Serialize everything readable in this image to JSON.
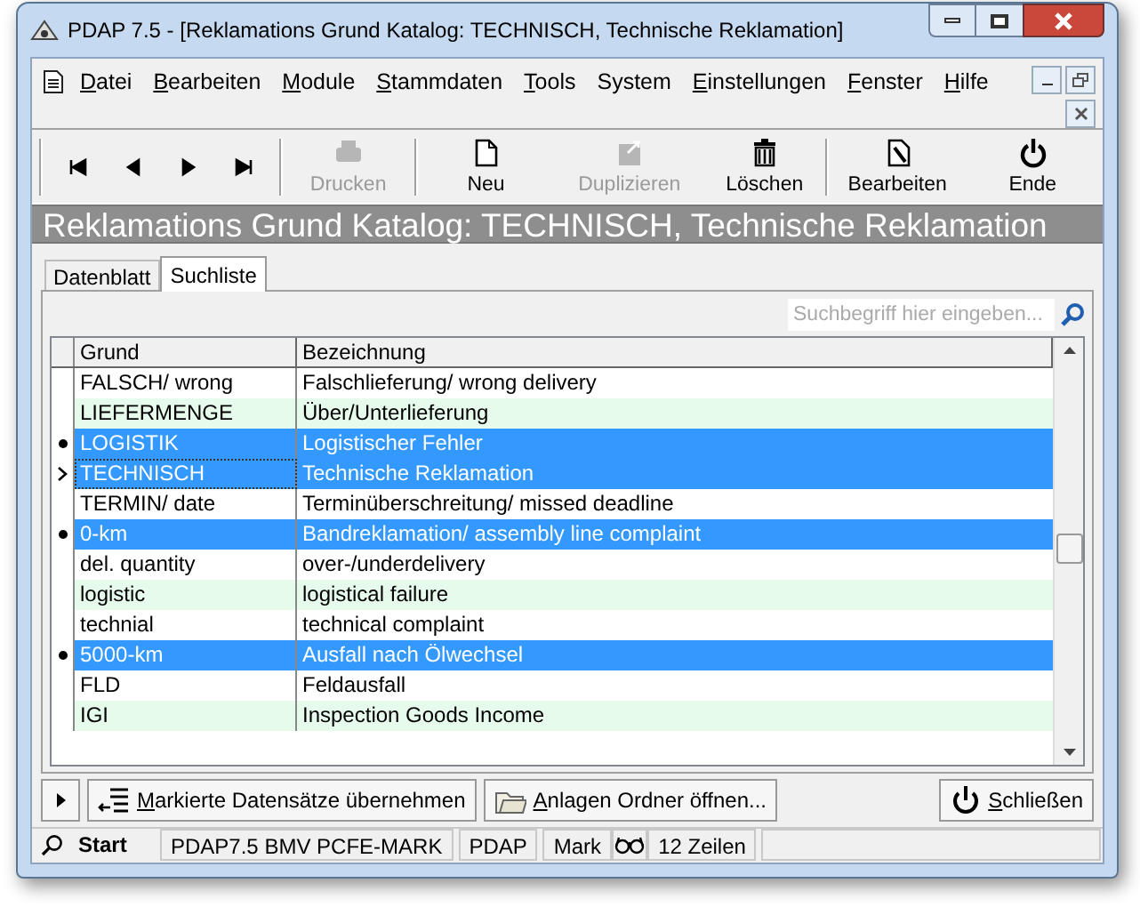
{
  "window": {
    "title": "PDAP 7.5 - [Reklamations Grund Katalog:  TECHNISCH, Technische Reklamation]"
  },
  "menu": [
    {
      "label": "Datei",
      "underlined": true
    },
    {
      "label": "Bearbeiten",
      "underlined": true
    },
    {
      "label": "Module",
      "underlined": true
    },
    {
      "label": "Stammdaten",
      "underlined": true
    },
    {
      "label": "Tools",
      "underlined": true
    },
    {
      "label": "System",
      "underlined": false
    },
    {
      "label": "Einstellungen",
      "underlined": true
    },
    {
      "label": "Fenster",
      "underlined": true
    },
    {
      "label": "Hilfe",
      "underlined": true
    }
  ],
  "toolbar": [
    {
      "kind": "nav"
    },
    {
      "kind": "print",
      "label": "Drucken",
      "disabled": true
    },
    {
      "kind": "new",
      "label": "Neu",
      "disabled": false
    },
    {
      "kind": "duplicate",
      "label": "Duplizieren",
      "disabled": true
    },
    {
      "kind": "delete",
      "label": "Löschen",
      "disabled": false
    },
    {
      "kind": "edit",
      "label": "Bearbeiten",
      "disabled": false
    },
    {
      "kind": "exit",
      "label": "Ende",
      "disabled": false
    }
  ],
  "header": "Reklamations Grund Katalog:  TECHNISCH, Technische Reklamation",
  "tabs": [
    {
      "label": "Datenblatt",
      "selected": false
    },
    {
      "label": "Suchliste",
      "selected": true
    }
  ],
  "search": {
    "placeholder": "Suchbegriff hier eingeben..."
  },
  "table": {
    "columns": [
      "Grund",
      "Bezeichnung"
    ],
    "rows": [
      {
        "cells": [
          "FALSCH/ wrong",
          "Falschlieferung/ wrong delivery"
        ],
        "selected": false,
        "marked": false,
        "current": false
      },
      {
        "cells": [
          "LIEFERMENGE",
          "Über/Unterlieferung"
        ],
        "selected": false,
        "marked": false,
        "current": false
      },
      {
        "cells": [
          "LOGISTIK",
          "Logistischer Fehler"
        ],
        "selected": true,
        "marked": true,
        "current": false
      },
      {
        "cells": [
          "TECHNISCH",
          "Technische Reklamation"
        ],
        "selected": true,
        "marked": false,
        "current": true
      },
      {
        "cells": [
          "TERMIN/ date",
          "Terminüberschreitung/ missed deadline"
        ],
        "selected": false,
        "marked": false,
        "current": false
      },
      {
        "cells": [
          "0-km",
          "Bandreklamation/ assembly line complaint"
        ],
        "selected": true,
        "marked": true,
        "current": false
      },
      {
        "cells": [
          "del. quantity",
          "over-/underdelivery"
        ],
        "selected": false,
        "marked": false,
        "current": false
      },
      {
        "cells": [
          "logistic",
          "logistical failure"
        ],
        "selected": false,
        "marked": false,
        "current": false
      },
      {
        "cells": [
          "technial",
          "technical complaint"
        ],
        "selected": false,
        "marked": false,
        "current": false
      },
      {
        "cells": [
          "5000-km",
          "Ausfall nach Ölwechsel"
        ],
        "selected": true,
        "marked": true,
        "current": false
      },
      {
        "cells": [
          "FLD",
          "Feldausfall"
        ],
        "selected": false,
        "marked": false,
        "current": false
      },
      {
        "cells": [
          "IGI",
          "Inspection Goods Income"
        ],
        "selected": false,
        "marked": false,
        "current": false
      }
    ]
  },
  "buttons": [
    {
      "kind": "take",
      "label": "Markierte Datensätze übernehmen"
    },
    {
      "kind": "folder",
      "label": "Anlagen Ordner öffnen..."
    },
    {
      "kind": "close",
      "label": "Schließen"
    }
  ],
  "status_bar": {
    "start": "Start",
    "fields": [
      "PDAP7.5 BMV PCFE-MARK",
      "PDAP",
      "Mark"
    ],
    "rows": "12 Zeilen"
  }
}
